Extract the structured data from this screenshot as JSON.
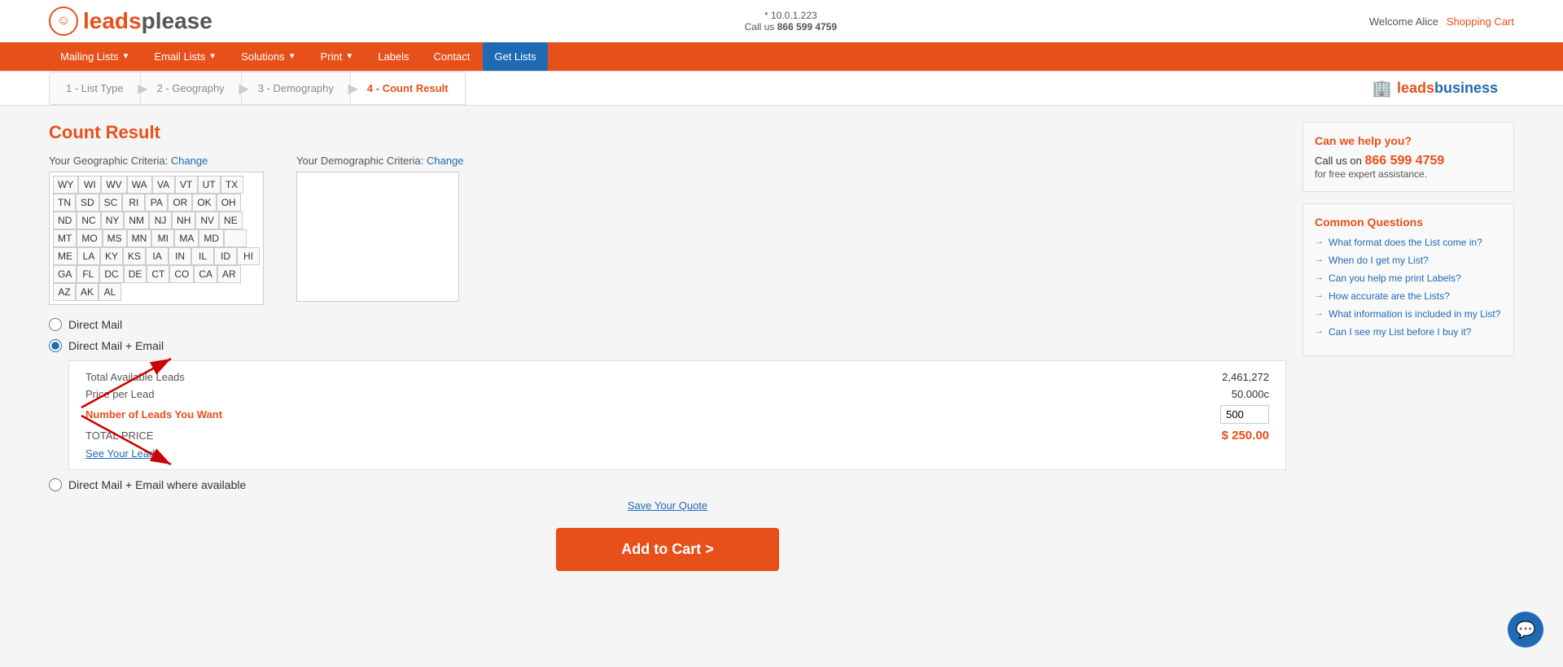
{
  "meta": {
    "ip": "* 10.0.1.223",
    "phone": "866 599 4759",
    "welcome": "Welcome Alice",
    "shopping_cart": "Shopping Cart"
  },
  "logo": {
    "leads": "leads",
    "please": "please"
  },
  "nav": {
    "items": [
      {
        "label": "Mailing Lists",
        "dropdown": true
      },
      {
        "label": "Email Lists",
        "dropdown": true
      },
      {
        "label": "Solutions",
        "dropdown": true
      },
      {
        "label": "Print",
        "dropdown": true
      },
      {
        "label": "Labels",
        "dropdown": false
      },
      {
        "label": "Contact",
        "dropdown": false
      },
      {
        "label": "Get Lists",
        "dropdown": false,
        "active": true
      }
    ]
  },
  "breadcrumb": {
    "steps": [
      {
        "number": "1",
        "label": "List Type"
      },
      {
        "number": "2",
        "label": "Geography"
      },
      {
        "number": "3",
        "label": "Demography"
      },
      {
        "number": "4",
        "label": "Count Result",
        "active": true
      }
    ],
    "brand": {
      "leads": "leads",
      "business": "business"
    }
  },
  "page": {
    "title": "Count Result",
    "geo_criteria_label": "Your Geographic Criteria:",
    "geo_change_link": "Change",
    "demo_criteria_label": "Your Demographic Criteria:",
    "demo_change_link": "Change"
  },
  "states": [
    [
      "WY",
      "WI",
      "WV",
      "WA",
      "VA",
      "VT",
      "UT",
      "TX"
    ],
    [
      "TN",
      "SD",
      "SC",
      "RI",
      "PA",
      "OR",
      "OK",
      "OH"
    ],
    [
      "ND",
      "NC",
      "NY",
      "NM",
      "NJ",
      "NH",
      "NV",
      "NE"
    ],
    [
      "MT",
      "MO",
      "MS",
      "MN",
      "MI",
      "MA",
      "MD",
      ""
    ],
    [
      "ME",
      "LA",
      "KY",
      "KS",
      "IA",
      "IN",
      "IL",
      "ID",
      "HI"
    ],
    [
      "GA",
      "FL",
      "DC",
      "DE",
      "CT",
      "CO",
      "CA",
      "AR"
    ],
    [
      "AZ",
      "AK",
      "AL"
    ]
  ],
  "options": {
    "direct_mail": {
      "label": "Direct Mail",
      "selected": false
    },
    "direct_mail_email": {
      "label": "Direct Mail + Email",
      "selected": true,
      "total_available_label": "Total Available Leads",
      "total_available_value": "2,461,272",
      "price_per_lead_label": "Price per Lead",
      "price_per_lead_value": "50.000c",
      "num_leads_label": "Number of Leads You Want",
      "num_leads_value": "500",
      "total_price_label": "TOTAL PRICE",
      "total_price_value": "$ 250.00",
      "see_leads_label": "See Your Leads"
    },
    "direct_mail_email_where": {
      "label": "Direct Mail + Email where available",
      "selected": false
    }
  },
  "save_quote": "Save Your Quote",
  "add_to_cart": "Add to Cart >",
  "help": {
    "title": "Can we help you?",
    "call_label": "Call us on",
    "phone": "866 599 4759",
    "subtitle": "for free expert assistance."
  },
  "questions": {
    "title": "Common Questions",
    "items": [
      "What format does the List come in?",
      "When do I get my List?",
      "Can you help me print Labels?",
      "How accurate are the Lists?",
      "What information is included in my List?",
      "Can I see my List before I buy it?"
    ]
  }
}
